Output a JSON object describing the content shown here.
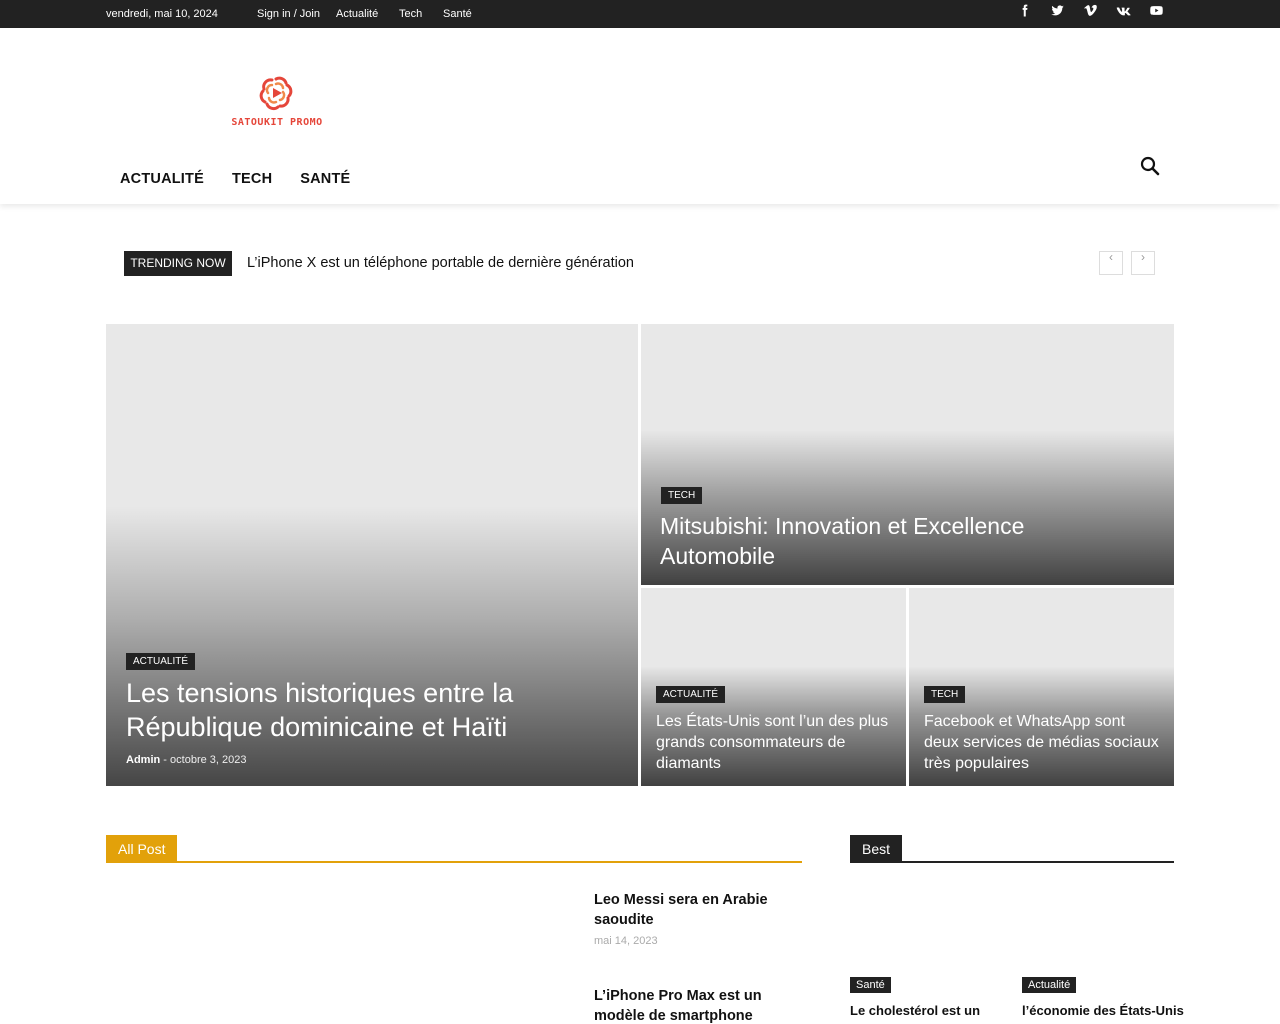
{
  "topbar": {
    "date": "vendredi, mai 10, 2024",
    "links": [
      "Sign in / Join",
      "Actualité",
      "Tech",
      "Santé"
    ],
    "social_icons": [
      "facebook-icon",
      "twitter-icon",
      "vimeo-icon",
      "vk-icon",
      "youtube-icon"
    ]
  },
  "header": {
    "logo_text": "SATOUKIT PROMO",
    "nav": [
      "ACTUALITÉ",
      "TECH",
      "SANTÉ"
    ]
  },
  "trending": {
    "label": "TRENDING NOW",
    "headline": "L’iPhone X est un téléphone portable de dernière génération",
    "prev": "‹",
    "next": "›"
  },
  "hero": {
    "main": {
      "category": "ACTUALITÉ",
      "title": "Les tensions historiques entre la République dominicaine et Haïti",
      "author": "Admin",
      "sep": "-",
      "date": "octobre 3, 2023"
    },
    "top_right": {
      "category": "TECH",
      "title": "Mitsubishi: Innovation et Excellence Automobile"
    },
    "bottom_left": {
      "category": "ACTUALITÉ",
      "title": "Les États-Unis sont l’un des plus grands consommateurs de diamants"
    },
    "bottom_right": {
      "category": "TECH",
      "title": "Facebook et WhatsApp sont deux services de médias sociaux très populaires"
    }
  },
  "all_post": {
    "heading": "All Post",
    "posts": [
      {
        "title": "Leo Messi sera en Arabie saoudite",
        "date": "mai 14, 2023"
      },
      {
        "title": "L’iPhone Pro Max est un modèle de smartphone",
        "date": ""
      }
    ]
  },
  "best": {
    "heading": "Best",
    "items": [
      {
        "category": "Santé",
        "title": "Le cholestérol est un"
      },
      {
        "category": "Actualité",
        "title": "l’économie des États-Unis"
      }
    ]
  },
  "colors": {
    "accent": "#e2a10a",
    "dark": "#222222",
    "logo": "#e5463a"
  }
}
